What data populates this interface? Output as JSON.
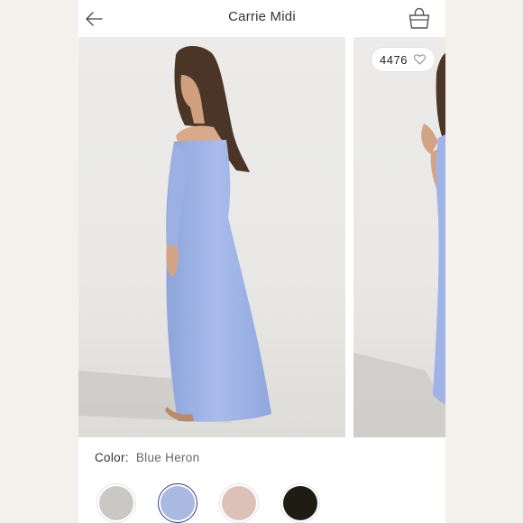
{
  "header": {
    "title": "Carrie Midi",
    "back_icon": "arrow-left-icon",
    "bag_icon": "shopping-bag-icon"
  },
  "gallery": {
    "likes_count": "4476",
    "like_icon": "heart-icon"
  },
  "color": {
    "label": "Color:",
    "selected": "Blue Heron",
    "swatches": [
      {
        "color": "#c9c8c4",
        "selected": false
      },
      {
        "color": "#aab9df",
        "selected": true
      },
      {
        "color": "#dcc1b8",
        "selected": false
      },
      {
        "color": "#1f1c14",
        "selected": false
      }
    ]
  },
  "colors": {
    "background": "#f4f1ed",
    "screen": "#ffffff",
    "dress": "#9fb3e6",
    "selected_ring": "#2d3d7a"
  }
}
